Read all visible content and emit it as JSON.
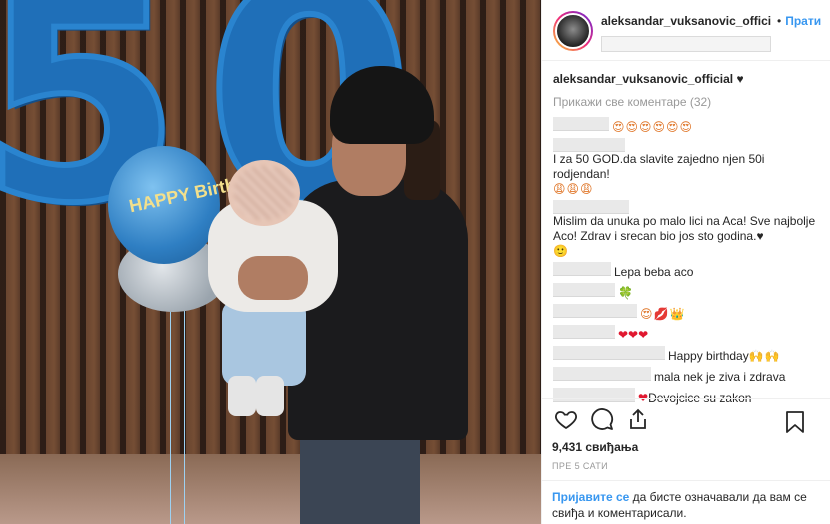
{
  "post": {
    "username": "aleksandar_vuksanovic_offici",
    "follow_label": "Прати",
    "caption_username": "aleksandar_vuksanovic_official",
    "caption_text": "♥",
    "view_all_comments": "Прикажи све коментаре (32)",
    "likes": "9,431 свиђања",
    "time": "ПРЕ 5 САТИ",
    "login_link": "Пријавите се",
    "login_text": "да бисте означавали да вам се свиђа и коментарисали."
  },
  "photo": {
    "balloon_digits": [
      "5",
      "0"
    ],
    "balloon_text": "HAPPY Birthday"
  },
  "comments": [
    {
      "text": "",
      "emoji": "😍😍😍😍😍😍"
    },
    {
      "text": "I za 50 GOD.da slavite zajedno njen 50i rodjendan!",
      "emoji": "😩😩😩"
    },
    {
      "text": "Mislim da unuka po malo lici na Aca! Sve najbolje Aco! Zdrav i srecan bio jos sto godina.♥",
      "emoji": "🙂"
    },
    {
      "text": "Lepa beba aco",
      "emoji": ""
    },
    {
      "text": "",
      "emoji": "🍀"
    },
    {
      "text": "",
      "emoji": "😍💋👑"
    },
    {
      "text": "",
      "emoji": "❤❤❤"
    },
    {
      "text": "Happy birthday",
      "emoji": "🙌🙌"
    },
    {
      "text": "mala nek je ziva i zdrava",
      "emoji": ""
    },
    {
      "text": "Devojcice su zakon",
      "emoji": "❤"
    }
  ],
  "icons": [
    "heart-icon",
    "comment-icon",
    "share-icon",
    "bookmark-icon"
  ]
}
